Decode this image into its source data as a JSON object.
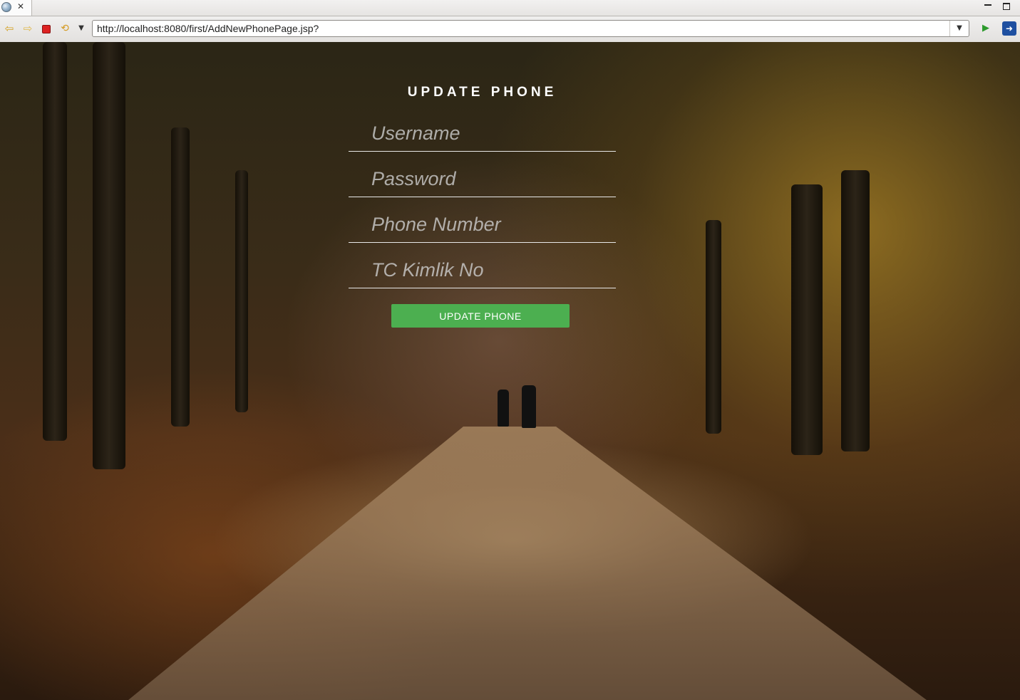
{
  "browser": {
    "tab_icon": "globe-icon",
    "tab_close_glyph": "✕",
    "url": "http://localhost:8080/first/AddNewPhonePage.jsp?",
    "toolbar_icons": [
      "back-arrow-icon",
      "forward-arrow-icon",
      "stop-icon",
      "refresh-icon",
      "dropdown-icon",
      "go-icon",
      "eclipse-icon"
    ]
  },
  "form": {
    "title": "UPDATE PHONE",
    "fields": [
      {
        "placeholder": "Username"
      },
      {
        "placeholder": "Password"
      },
      {
        "placeholder": "Phone Number"
      },
      {
        "placeholder": "TC Kimlik No"
      }
    ],
    "submit_label": "UPDATE PHONE"
  },
  "colors": {
    "button": "#4caf50",
    "text": "#ffffff"
  }
}
